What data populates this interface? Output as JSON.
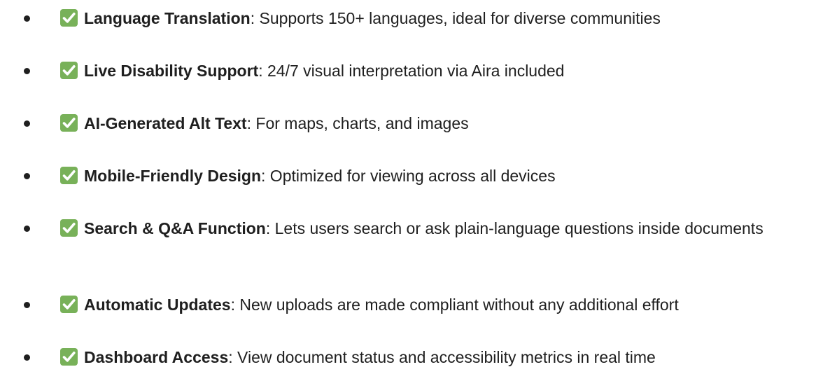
{
  "features": [
    {
      "icon": "check-mark-icon",
      "title": "Language Translation",
      "separator": ":",
      "description": " Supports 150+ languages, ideal for diverse communities"
    },
    {
      "icon": "check-mark-icon",
      "title": "Live Disability Support",
      "separator": ":",
      "description": " 24/7 visual interpretation via Aira included"
    },
    {
      "icon": "check-mark-icon",
      "title": "AI-Generated Alt Text",
      "separator": ":",
      "description": " For maps, charts, and images"
    },
    {
      "icon": "check-mark-icon",
      "title": "Mobile-Friendly Design",
      "separator": ":",
      "description": " Optimized for viewing across all devices"
    },
    {
      "icon": "check-mark-icon",
      "title": "Search & Q&A Function",
      "separator": ":",
      "description": " Lets users search or ask plain-language questions inside documents"
    },
    {
      "icon": "check-mark-icon",
      "title": "Automatic Updates",
      "separator": ":",
      "description": " New uploads are made compliant without any additional effort"
    },
    {
      "icon": "check-mark-icon",
      "title": "Dashboard Access",
      "separator": ":",
      "description": " View document status and accessibility metrics in real time"
    }
  ],
  "colors": {
    "check_background": "#78b159",
    "text": "#1f1f1f"
  }
}
